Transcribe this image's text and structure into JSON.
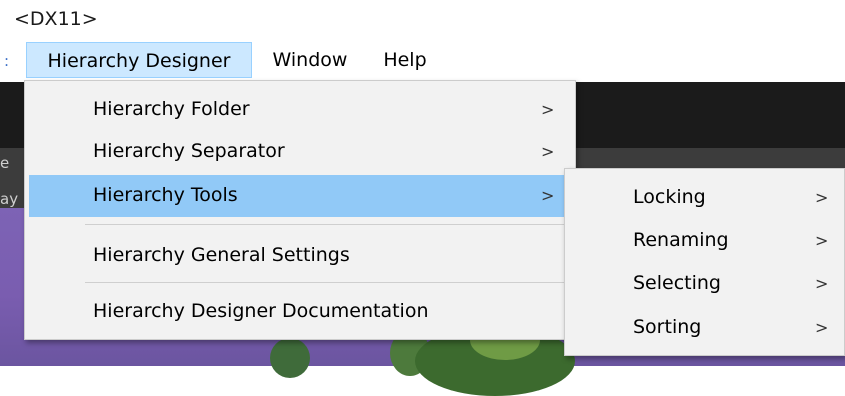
{
  "window": {
    "title": "<DX11>"
  },
  "menu_bar": {
    "edge_glyph": ":",
    "items": [
      {
        "label": "Hierarchy Designer",
        "active": true
      },
      {
        "label": "Window",
        "active": false
      },
      {
        "label": "Help",
        "active": false
      }
    ]
  },
  "background": {
    "edge_text_1": "e",
    "edge_text_2": "ay"
  },
  "menu": {
    "items": [
      {
        "label": "Hierarchy Folder",
        "has_submenu": true,
        "arrow": ">"
      },
      {
        "label": "Hierarchy Separator",
        "has_submenu": true,
        "arrow": ">"
      },
      {
        "label": "Hierarchy Tools",
        "has_submenu": true,
        "arrow": ">",
        "highlighted": true
      },
      {
        "label": "Hierarchy General Settings",
        "has_submenu": false
      },
      {
        "label": "Hierarchy Designer Documentation",
        "has_submenu": false
      }
    ]
  },
  "submenu": {
    "items": [
      {
        "label": "Locking",
        "arrow": ">"
      },
      {
        "label": "Renaming",
        "arrow": ">"
      },
      {
        "label": "Selecting",
        "arrow": ">"
      },
      {
        "label": "Sorting",
        "arrow": ">"
      }
    ]
  },
  "colors": {
    "highlight": "#91c9f7",
    "menu_active_bg": "#cce8ff",
    "menu_bg": "#f2f2f2"
  }
}
